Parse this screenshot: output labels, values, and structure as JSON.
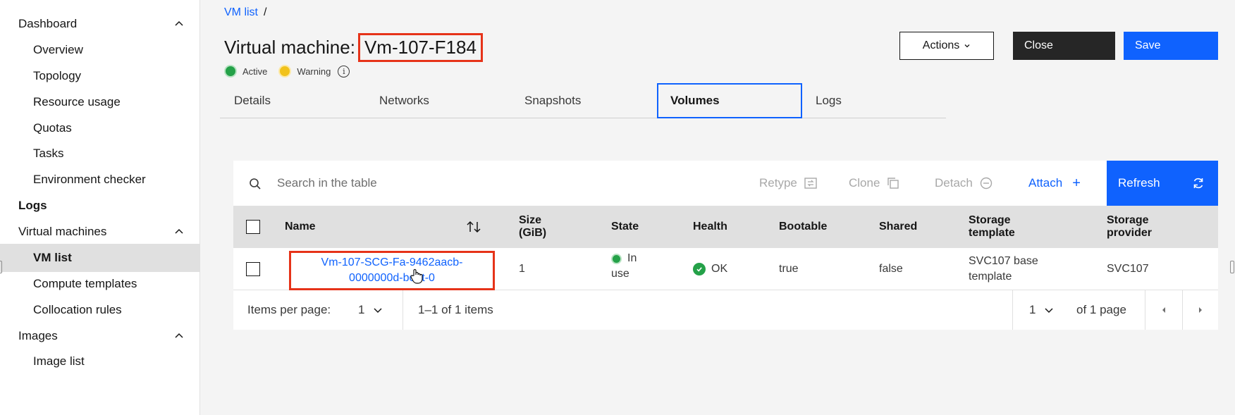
{
  "sidebar": {
    "sections": [
      {
        "label": "Dashboard",
        "items": [
          "Overview",
          "Topology",
          "Resource usage",
          "Quotas",
          "Tasks",
          "Environment checker"
        ]
      },
      {
        "label": "Logs"
      },
      {
        "label": "Virtual machines",
        "items": [
          "VM list",
          "Compute templates",
          "Collocation rules"
        ],
        "active": "VM list"
      },
      {
        "label": "Images",
        "items": [
          "Image list"
        ]
      }
    ],
    "labels": {
      "dashboard": "Dashboard",
      "overview": "Overview",
      "topology": "Topology",
      "resource_usage": "Resource usage",
      "quotas": "Quotas",
      "tasks": "Tasks",
      "environment_checker": "Environment checker",
      "logs": "Logs",
      "virtual_machines": "Virtual machines",
      "vm_list": "VM list",
      "compute_templates": "Compute templates",
      "collocation_rules": "Collocation rules",
      "images": "Images",
      "image_list": "Image list"
    }
  },
  "breadcrumb": {
    "link": "VM list",
    "separator": "/"
  },
  "header": {
    "title_prefix": "Virtual machine:",
    "vm_name": "Vm-107-F184",
    "status_active": "Active",
    "status_warning": "Warning",
    "info_glyph": "i"
  },
  "buttons": {
    "actions": "Actions",
    "close": "Close",
    "save": "Save"
  },
  "tabs": [
    "Details",
    "Networks",
    "Snapshots",
    "Volumes",
    "Logs"
  ],
  "active_tab": "Volumes",
  "toolbar": {
    "search_placeholder": "Search in the table",
    "retype": "Retype",
    "clone": "Clone",
    "detach": "Detach",
    "attach": "Attach",
    "attach_icon": "+",
    "refresh": "Refresh"
  },
  "table": {
    "columns": {
      "name": "Name",
      "size_1": "Size",
      "size_2": "(GiB)",
      "state": "State",
      "health": "Health",
      "bootable": "Bootable",
      "shared": "Shared",
      "storage_template_1": "Storage",
      "storage_template_2": "template",
      "storage_provider_1": "Storage",
      "storage_provider_2": "provider"
    },
    "rows": [
      {
        "name_line1": "Vm-107-SCG-Fa-9462aacb-",
        "name_line2": "0000000d-boot-0",
        "size": "1",
        "state_line1": "In",
        "state_line2": "use",
        "health": "OK",
        "bootable": "true",
        "shared": "false",
        "storage_template_line1": "SVC107 base",
        "storage_template_line2": "template",
        "storage_provider": "SVC107"
      }
    ]
  },
  "pagination": {
    "items_per_page_label": "Items per page:",
    "items_per_page": "1",
    "range": "1–1 of 1 items",
    "page": "1",
    "of_pages": "of 1 page"
  },
  "colors": {
    "accent": "#0f62fe",
    "highlight": "#e63319",
    "success": "#24a148",
    "warning": "#f1c21b"
  }
}
